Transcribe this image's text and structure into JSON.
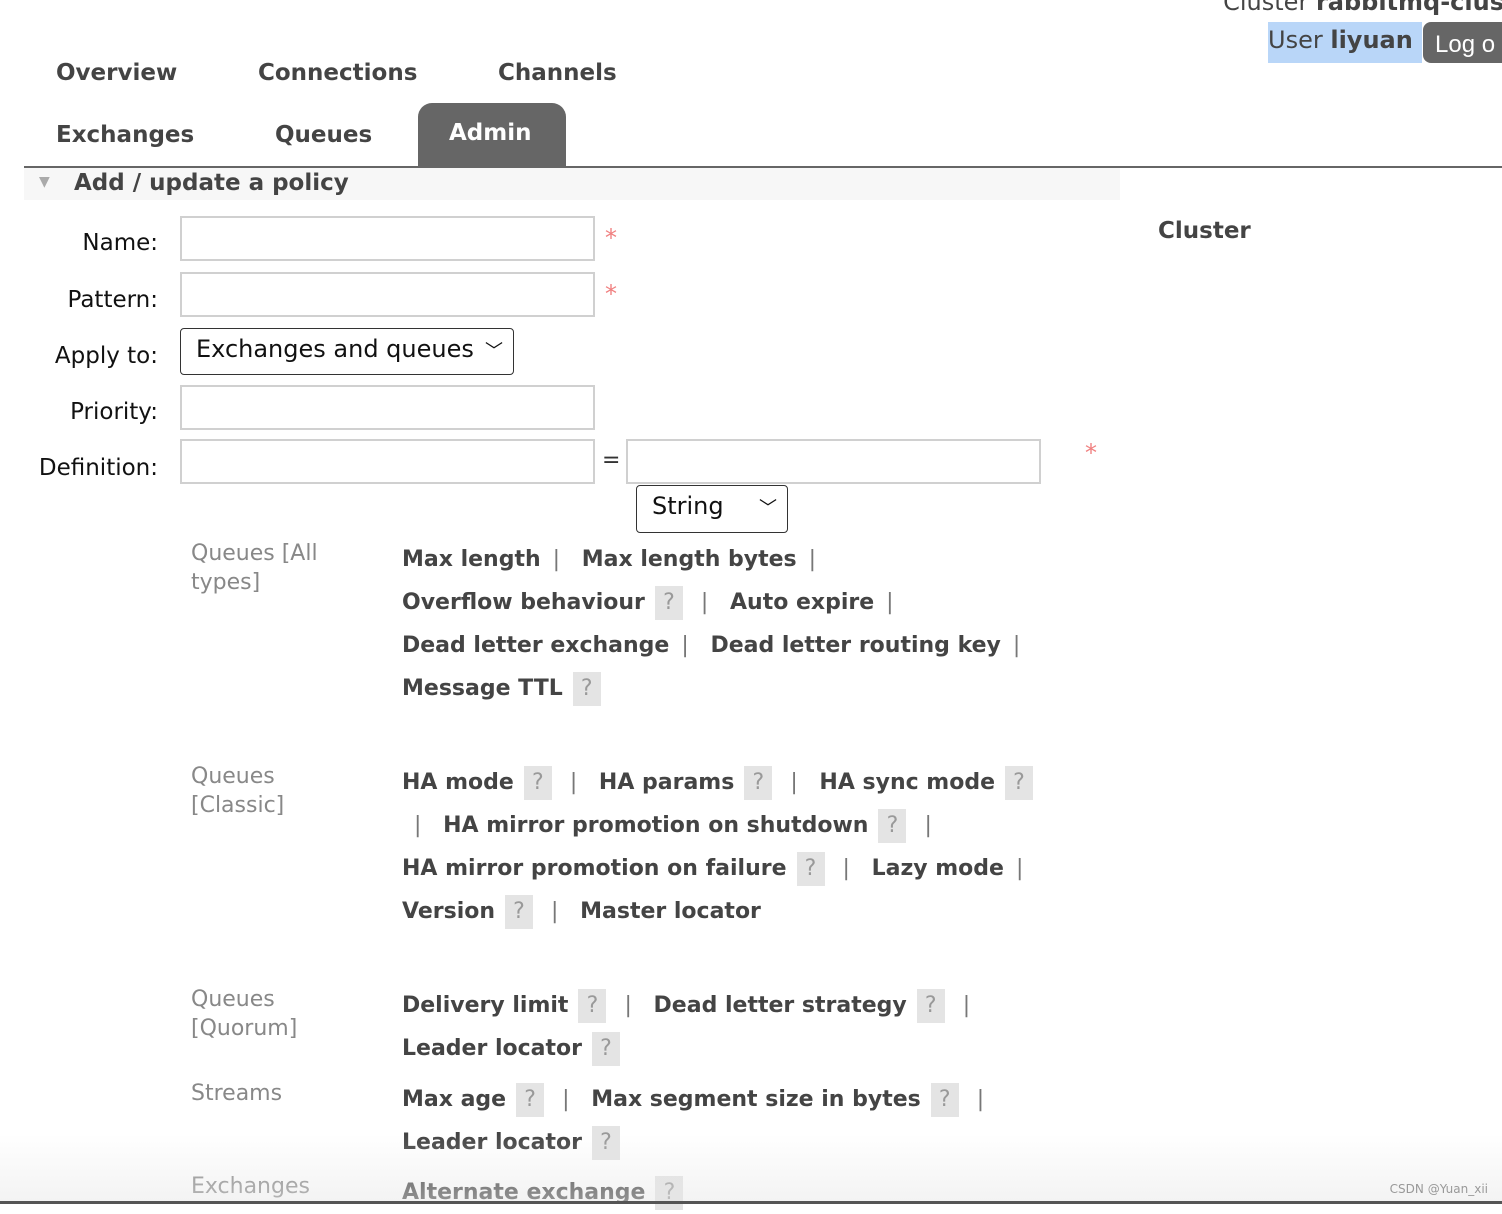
{
  "header": {
    "cluster_prefix": "Cluster ",
    "cluster_name": "rabbitmq-clus",
    "user_prefix": "User ",
    "user_name": "liyuan",
    "logout_label": "Log o"
  },
  "nav": {
    "overview": "Overview",
    "connections": "Connections",
    "channels": "Channels",
    "exchanges": "Exchanges",
    "queues": "Queues",
    "admin": "Admin",
    "active": "Admin"
  },
  "section": {
    "title": "Add / update a policy"
  },
  "sidebar": {
    "cluster": "Cluster"
  },
  "form": {
    "name_label": "Name:",
    "name_value": "",
    "pattern_label": "Pattern:",
    "pattern_value": "",
    "apply_label": "Apply to:",
    "apply_value": "Exchanges and queues",
    "priority_label": "Priority:",
    "priority_value": "",
    "definition_label": "Definition:",
    "definition_key": "",
    "definition_value": "",
    "equals": "=",
    "type_value": "String",
    "required_mark": "*"
  },
  "groups": [
    {
      "label": "Queues [All types]",
      "items": [
        {
          "t": "Max length"
        },
        {
          "t": "Max length bytes"
        },
        {
          "t": "Overflow behaviour",
          "h": true
        },
        {
          "t": "Auto expire"
        },
        {
          "t": "Dead letter exchange"
        },
        {
          "t": "Dead letter routing key"
        },
        {
          "t": "Message TTL",
          "h": true
        }
      ]
    },
    {
      "label": "Queues [Classic]",
      "items": [
        {
          "t": "HA mode",
          "h": true
        },
        {
          "t": "HA params",
          "h": true
        },
        {
          "t": "HA sync mode",
          "h": true
        },
        {
          "t": "HA mirror promotion on shutdown",
          "h": true
        },
        {
          "t": "HA mirror promotion on failure",
          "h": true
        },
        {
          "t": "Lazy mode"
        },
        {
          "t": "Version",
          "h": true
        },
        {
          "t": "Master locator"
        }
      ]
    },
    {
      "label": "Queues [Quorum]",
      "items": [
        {
          "t": "Delivery limit",
          "h": true
        },
        {
          "t": "Dead letter strategy",
          "h": true
        },
        {
          "t": "Leader locator",
          "h": true
        }
      ]
    },
    {
      "label": "Streams",
      "items": [
        {
          "t": "Max age",
          "h": true
        },
        {
          "t": "Max segment size in bytes",
          "h": true
        },
        {
          "t": "Leader locator",
          "h": true
        }
      ]
    },
    {
      "label": "Exchanges",
      "items": [
        {
          "t": "Alternate exchange",
          "h": true
        }
      ]
    }
  ],
  "help_glyph": "?",
  "separator": "|",
  "watermark": "CSDN @Yuan_xii",
  "colors": {
    "tab_active": "#666666",
    "user_highlight": "#b9d6f8",
    "required": "#f08080"
  }
}
